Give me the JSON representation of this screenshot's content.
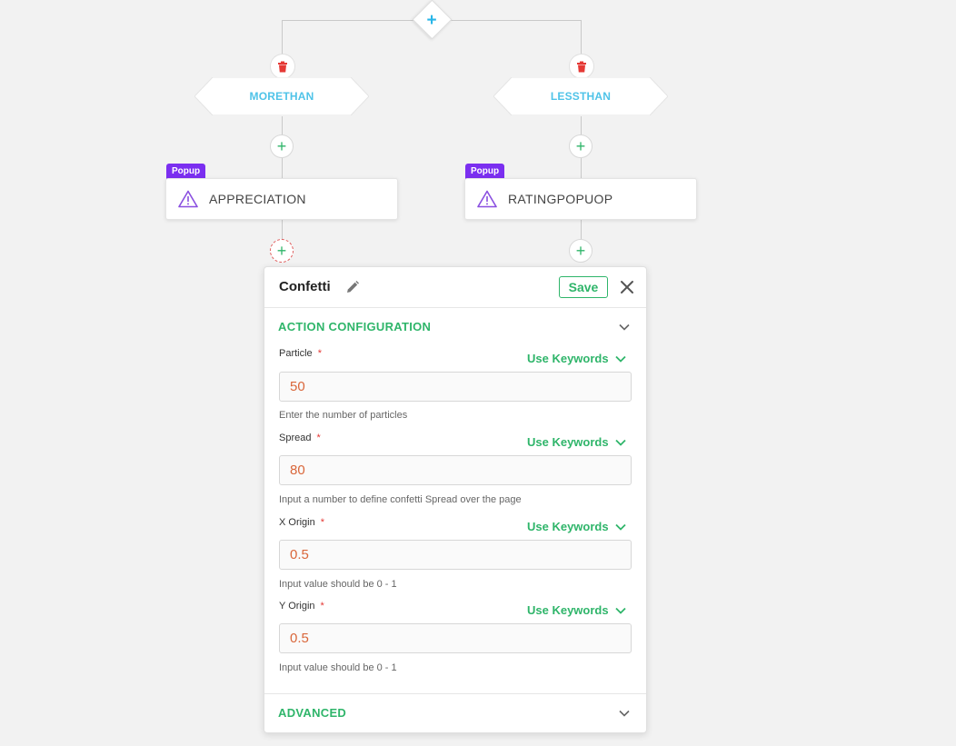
{
  "flow": {
    "root_add_icon": "plus-icon",
    "branches": [
      {
        "condition": "MORETHAN",
        "delete_icon": "trash-icon",
        "action_badge": "Popup",
        "action_name": "APPRECIATION"
      },
      {
        "condition": "LESSTHAN",
        "delete_icon": "trash-icon",
        "action_badge": "Popup",
        "action_name": "RATINGPOPUOP"
      }
    ]
  },
  "panel": {
    "title": "Confetti",
    "save_label": "Save",
    "sections": {
      "action_configuration": "ACTION CONFIGURATION",
      "advanced": "ADVANCED"
    },
    "fields": [
      {
        "label": "Particle",
        "required": "*",
        "keywords_label": "Use Keywords",
        "value": "50",
        "help": "Enter the number of particles"
      },
      {
        "label": "Spread",
        "required": "*",
        "keywords_label": "Use Keywords",
        "value": "80",
        "help": "Input a number to define confetti Spread over the page"
      },
      {
        "label": "X Origin",
        "required": "*",
        "keywords_label": "Use Keywords",
        "value": "0.5",
        "help": "Input value should be 0 - 1"
      },
      {
        "label": "Y Origin",
        "required": "*",
        "keywords_label": "Use Keywords",
        "value": "0.5",
        "help": "Input value should be 0 - 1"
      }
    ]
  },
  "colors": {
    "accent_green": "#2fb56a",
    "condition_blue": "#4fc3e8",
    "badge_purple": "#7b2ff0",
    "delete_red": "#e53935",
    "value_orange": "#d9663a"
  }
}
